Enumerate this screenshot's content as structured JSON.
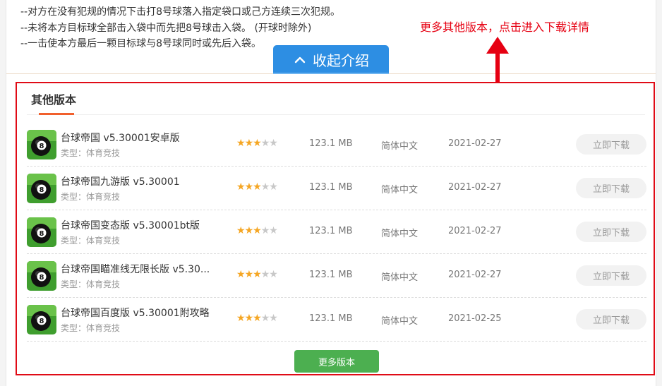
{
  "intro": {
    "rules": [
      "--对方在没有犯规的情况下击打8号球落入指定袋口或己方连续三次犯规。",
      "--未将本方目标球全部击入袋中而先把8号球击入袋。  (开球时除外)",
      "--一击使本方最后一颗目标球与8号球同时或先后入袋。"
    ],
    "collapse_label": "收起介绍"
  },
  "annotation": {
    "text": "更多其他版本，点击进入下载详情",
    "color": "#e60012"
  },
  "versions": {
    "title": "其他版本",
    "items": [
      {
        "name": "台球帝国 v5.30001安卓版",
        "type": "类型：体育竞技",
        "rating": 3,
        "size": "123.1 MB",
        "language": "简体中文",
        "date": "2021-02-27",
        "button": "立即下载"
      },
      {
        "name": "台球帝国九游版 v5.30001",
        "type": "类型：体育竞技",
        "rating": 3,
        "size": "123.1 MB",
        "language": "简体中文",
        "date": "2021-02-27",
        "button": "立即下载"
      },
      {
        "name": "台球帝国变态版 v5.30001bt版",
        "type": "类型：体育竞技",
        "rating": 3,
        "size": "123.1 MB",
        "language": "简体中文",
        "date": "2021-02-27",
        "button": "立即下载"
      },
      {
        "name": "台球帝国瞄准线无限长版 v5.30...",
        "type": "类型：体育竞技",
        "rating": 3,
        "size": "123.1 MB",
        "language": "简体中文",
        "date": "2021-02-27",
        "button": "立即下载"
      },
      {
        "name": "台球帝国百度版 v5.30001附攻略",
        "type": "类型：体育竞技",
        "rating": 3,
        "size": "123.1 MB",
        "language": "简体中文",
        "date": "2021-02-25",
        "button": "立即下载"
      }
    ],
    "more_button": "更多版本"
  },
  "icons": {
    "collapse": "chevron-up-icon",
    "annotation": "red-arrow-up-icon",
    "game": "billiard-8-ball-app-icon",
    "rating": "star-icon"
  },
  "colors": {
    "accent_blue": "#2d8ee3",
    "highlight_red": "#e00b16",
    "title_underline": "#f1602d",
    "star": "#f5a623",
    "more_button": "#4caf50"
  }
}
